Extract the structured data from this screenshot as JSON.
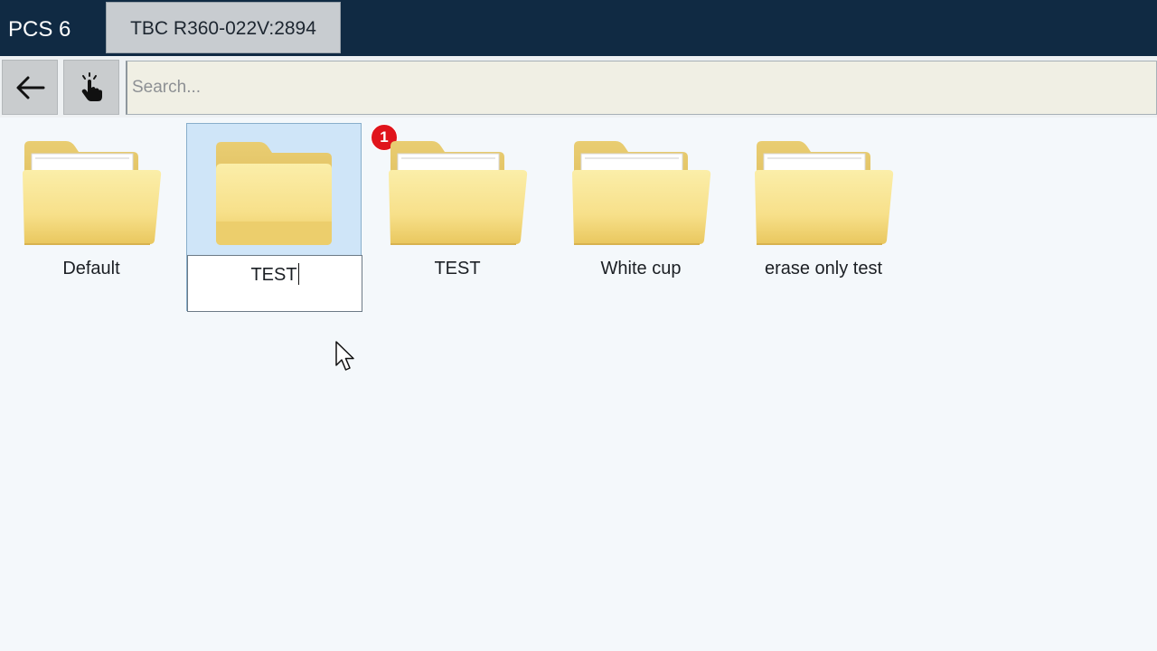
{
  "titlebar": {
    "app_title": "PCS 6",
    "device_tab": "TBC R360-022V:2894"
  },
  "toolbar": {
    "back_icon": "arrow-left-icon",
    "touch_icon": "hand-pointer-icon",
    "search_placeholder": "Search..."
  },
  "folders": [
    {
      "label": "Default",
      "state": "normal"
    },
    {
      "label": "TEST",
      "state": "renaming"
    },
    {
      "label": "TEST",
      "state": "normal"
    },
    {
      "label": "White cup",
      "state": "normal"
    },
    {
      "label": "erase only test",
      "state": "normal"
    }
  ],
  "notification_badge": "1",
  "colors": {
    "titlebar": "#102a43",
    "selection": "#cfe5f8",
    "badge": "#e0141b",
    "folder": "#f7e08a"
  }
}
